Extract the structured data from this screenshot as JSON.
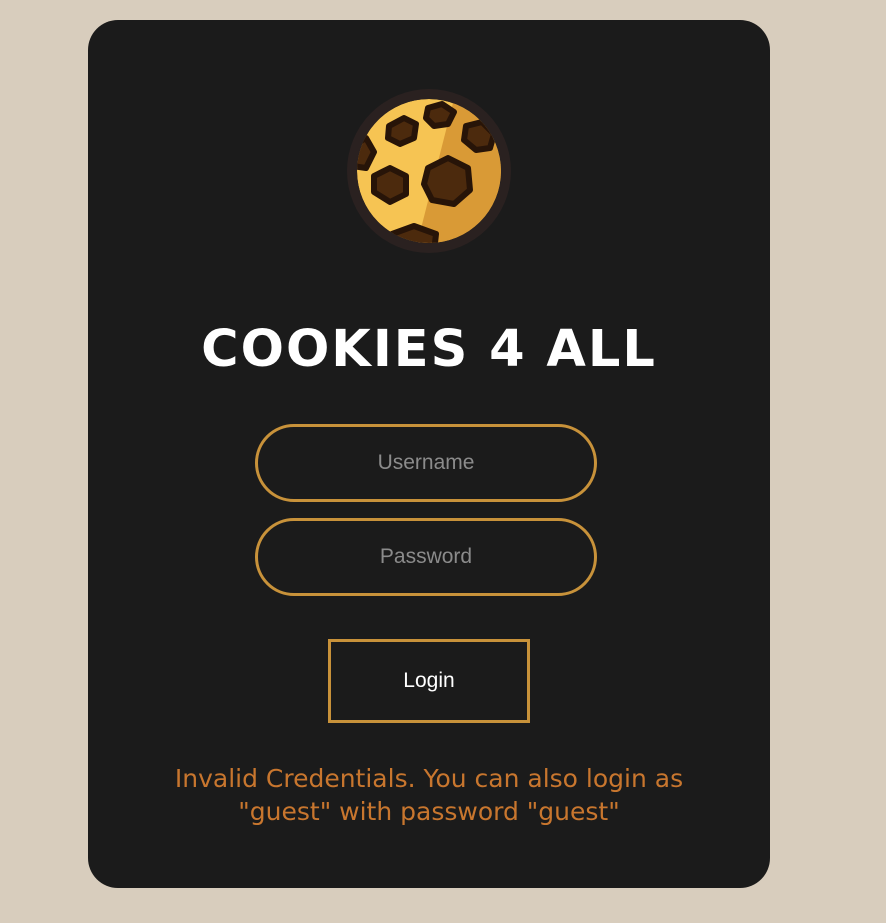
{
  "page": {
    "background_color": "#d8cdbd",
    "card_color": "#1b1b1b",
    "accent_color": "#c8923a",
    "error_color": "#c8762e"
  },
  "logo": {
    "icon": "cookie-icon"
  },
  "title": "COOKIES 4 ALL",
  "form": {
    "username_placeholder": "Username",
    "username_value": "",
    "password_placeholder": "Password",
    "password_value": "",
    "login_label": "Login"
  },
  "error": {
    "line1": "Invalid Credentials. You can also login as",
    "line2": "\"guest\" with password \"guest\""
  }
}
